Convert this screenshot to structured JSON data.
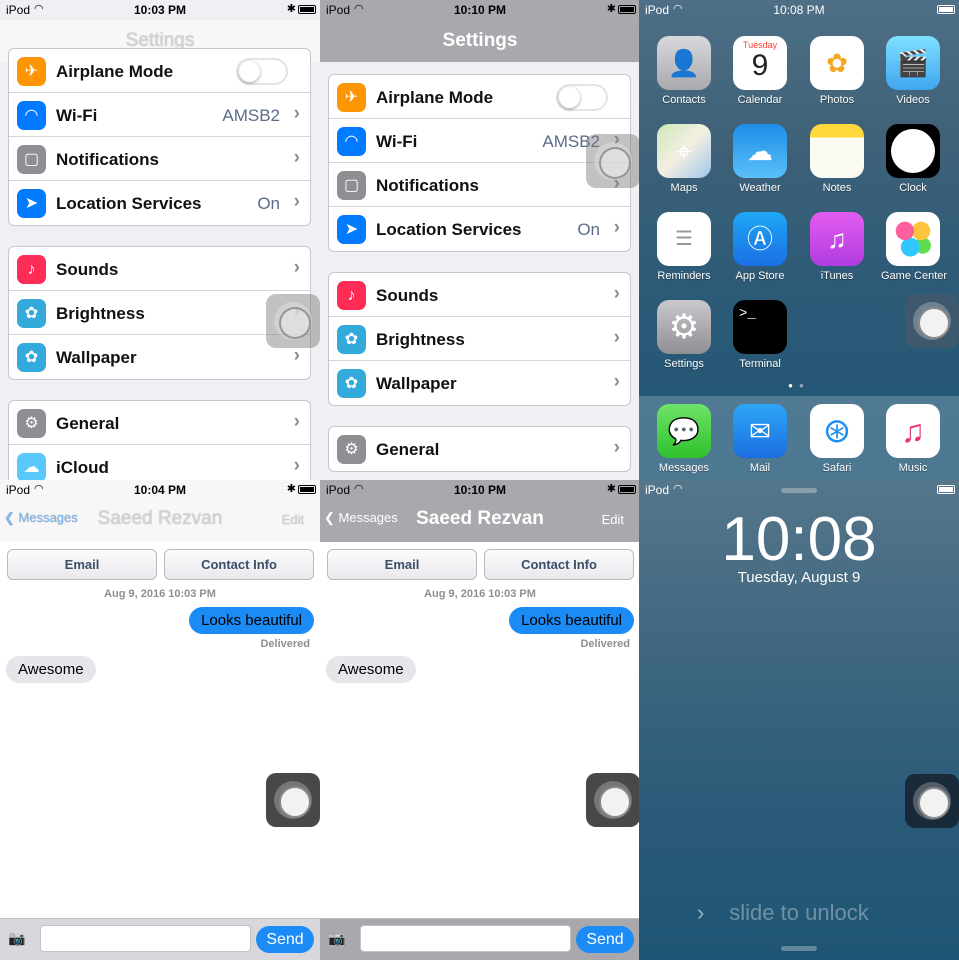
{
  "status": {
    "carrier": "iPod",
    "times": [
      "10:03 PM",
      "10:10 PM",
      "10:08 PM",
      "10:04 PM",
      "10:10 PM"
    ]
  },
  "settings": {
    "title": "Settings",
    "rows": {
      "airplane": "Airplane Mode",
      "wifi": "Wi-Fi",
      "wifi_value": "AMSB2",
      "notifications": "Notifications",
      "location": "Location Services",
      "location_value": "On",
      "sounds": "Sounds",
      "brightness": "Brightness",
      "wallpaper": "Wallpaper",
      "general": "General",
      "icloud": "iCloud"
    }
  },
  "home": {
    "apps": [
      "Contacts",
      "Calendar",
      "Photos",
      "Videos",
      "Maps",
      "Weather",
      "Notes",
      "Clock",
      "Reminders",
      "App Store",
      "iTunes",
      "Game Center",
      "Settings",
      "Terminal"
    ],
    "calendar_day": "Tuesday",
    "calendar_date": "9",
    "dock": [
      "Messages",
      "Mail",
      "Safari",
      "Music"
    ]
  },
  "messages": {
    "back": "Messages",
    "contact": "Saeed Rezvan",
    "edit": "Edit",
    "email_btn": "Email",
    "contact_btn": "Contact Info",
    "date": "Aug 9, 2016 10:03 PM",
    "outgoing": "Looks beautiful",
    "delivered": "Delivered",
    "incoming": "Awesome",
    "send": "Send"
  },
  "lock": {
    "time": "10:08",
    "date": "Tuesday, August 9",
    "slide": "slide to unlock"
  }
}
